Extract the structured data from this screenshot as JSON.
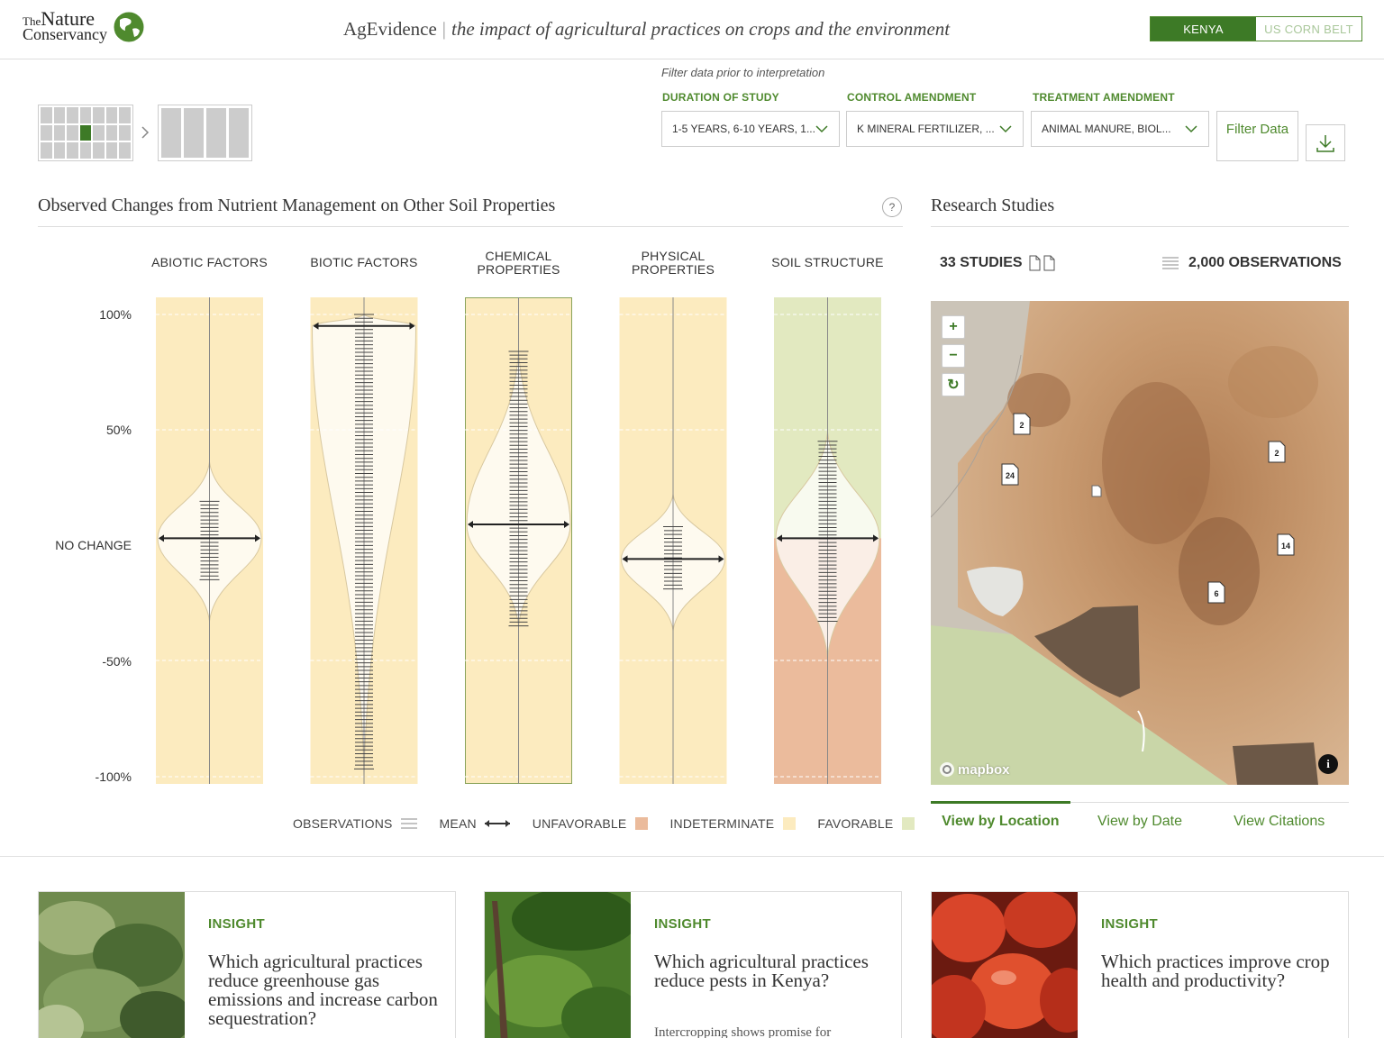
{
  "logo": {
    "line1a": "The",
    "line1b": "Nature",
    "line2": "Conservancy"
  },
  "app": {
    "name": "AgEvidence",
    "separator": "|",
    "tagline": "the impact of agricultural practices on crops and the environment"
  },
  "region_tabs": [
    {
      "label": "KENYA",
      "active": true
    },
    {
      "label": "US CORN BELT",
      "active": false
    }
  ],
  "filters": {
    "hint": "Filter data prior to interpretation",
    "duration": {
      "label": "DURATION OF STUDY",
      "value": "1-5 YEARS, 6-10 YEARS, 1..."
    },
    "control": {
      "label": "CONTROL AMENDMENT",
      "value": "K MINERAL FERTILIZER, ..."
    },
    "treatment": {
      "label": "TREATMENT AMENDMENT",
      "value": "ANIMAL MANURE, BIOL..."
    },
    "filter_button": "Filter Data",
    "download_icon": "download-icon"
  },
  "chart": {
    "title": "Observed Changes from Nutrient Management on Other Soil Properties",
    "help": "?",
    "y_labels": [
      "100%",
      "50%",
      "NO CHANGE",
      "-50%",
      "-100%"
    ],
    "legend": {
      "observations": "OBSERVATIONS",
      "mean": "MEAN",
      "unfavorable": "UNFAVORABLE",
      "indeterminate": "INDETERMINATE",
      "favorable": "FAVORABLE"
    }
  },
  "chart_data": {
    "type": "violin",
    "ylim": [
      -100,
      100
    ],
    "colors": {
      "indeterminate": "#fcebbf",
      "favorable": "#e2e9c0",
      "unfavorable": "#ebbb9c",
      "highlight_border": "#8aa35a"
    },
    "categories": [
      {
        "name": "ABIOTIC FACTORS",
        "mean": 3,
        "obs_min": -15,
        "obs_max": 19,
        "violin_top": 36,
        "violin_bottom": -33,
        "regions": [
          {
            "from": -100,
            "to": 100,
            "type": "indeterminate"
          }
        ],
        "highlight": false
      },
      {
        "name": "BIOTIC FACTORS",
        "mean": 95,
        "obs_min": -97,
        "obs_max": 100,
        "violin_top": 100,
        "violin_bottom": -100,
        "regions": [
          {
            "from": -100,
            "to": 100,
            "type": "indeterminate"
          }
        ],
        "highlight": false
      },
      {
        "name": "CHEMICAL PROPERTIES",
        "mean": 9,
        "obs_min": -35,
        "obs_max": 84,
        "violin_top": 84,
        "violin_bottom": -35,
        "regions": [
          {
            "from": -100,
            "to": 100,
            "type": "indeterminate"
          }
        ],
        "highlight": true
      },
      {
        "name": "PHYSICAL PROPERTIES",
        "mean": -6,
        "obs_min": -19,
        "obs_max": 8,
        "violin_top": 22,
        "violin_bottom": -37,
        "regions": [
          {
            "from": -100,
            "to": 100,
            "type": "indeterminate"
          }
        ],
        "highlight": false
      },
      {
        "name": "SOIL STRUCTURE",
        "mean": 3,
        "obs_min": -33,
        "obs_max": 45,
        "violin_top": 49,
        "violin_bottom": -49,
        "regions": [
          {
            "from": 3,
            "to": 100,
            "type": "favorable"
          },
          {
            "from": -100,
            "to": 3,
            "type": "unfavorable"
          }
        ],
        "highlight": false
      }
    ]
  },
  "research": {
    "title": "Research Studies",
    "studies": "33 STUDIES",
    "observations": "2,000 OBSERVATIONS",
    "map": {
      "attribution": "mapbox",
      "zoom_in": "+",
      "zoom_out": "−",
      "reset": "↻",
      "info": "i",
      "pins": [
        "2",
        "24",
        "",
        "2",
        "14",
        "6"
      ]
    },
    "tabs": [
      {
        "label": "View by Location",
        "active": true
      },
      {
        "label": "View by Date",
        "active": false
      },
      {
        "label": "View Citations",
        "active": false
      }
    ]
  },
  "insights": [
    {
      "tag": "INSIGHT",
      "title": "Which agricultural practices reduce greenhouse gas emissions and increase carbon sequestration?",
      "snippet": ""
    },
    {
      "tag": "INSIGHT",
      "title": "Which agricultural practices reduce pests in Kenya?",
      "snippet": "Intercropping shows promise for"
    },
    {
      "tag": "INSIGHT",
      "title": "Which practices improve crop health and productivity?",
      "snippet": ""
    }
  ]
}
